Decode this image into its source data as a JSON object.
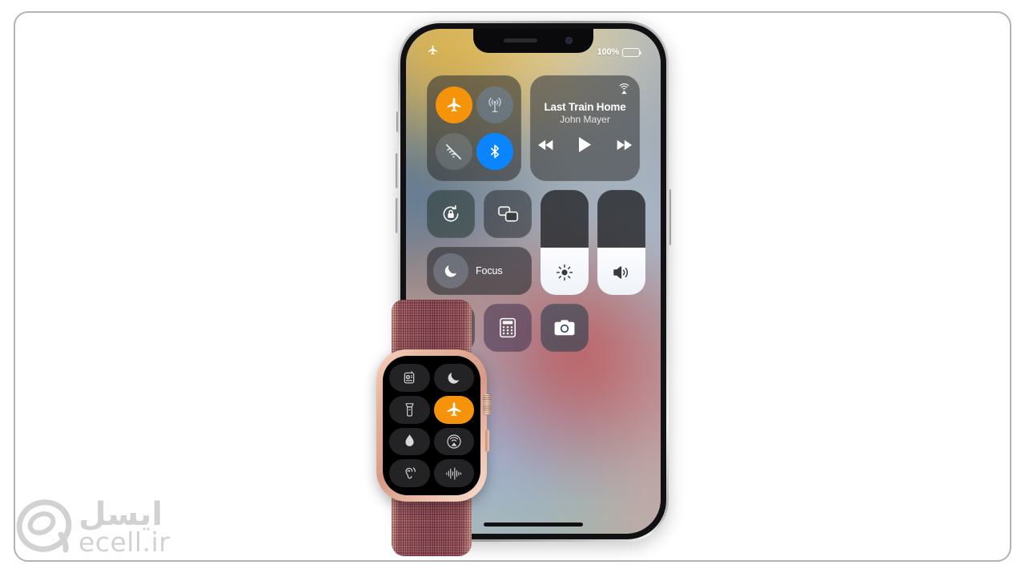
{
  "page": {
    "background_color": "#ffffff",
    "border_color": "#b3b3b3"
  },
  "iphone": {
    "status_bar": {
      "airplane_icon": "airplane-icon",
      "battery_percent": "100%",
      "battery_icon": "battery-full-icon"
    },
    "control_center": {
      "connectivity": {
        "label": "connectivity-module",
        "toggles": [
          {
            "name": "airplane-mode",
            "icon": "airplane-icon",
            "state": "on",
            "color": "#F5930A"
          },
          {
            "name": "cellular-data",
            "icon": "cellular-icon",
            "state": "dimmed",
            "color": "#6E87A5"
          },
          {
            "name": "wifi",
            "icon": "wifi-off-icon",
            "state": "off",
            "color": "#96A0AA"
          },
          {
            "name": "bluetooth",
            "icon": "bluetooth-icon",
            "state": "on",
            "color": "#0A84FF"
          }
        ]
      },
      "now_playing": {
        "title": "Last Train Home",
        "artist": "John Mayer",
        "airplay_icon": "airplay-audio-icon",
        "controls": [
          {
            "name": "rewind-button",
            "icon": "rewind-icon"
          },
          {
            "name": "play-button",
            "icon": "play-icon"
          },
          {
            "name": "forward-button",
            "icon": "fast-forward-icon"
          }
        ]
      },
      "toggles": [
        {
          "name": "rotation-lock",
          "icon": "rotation-lock-icon",
          "tint": "green"
        },
        {
          "name": "screen-mirror",
          "icon": "screen-mirroring-icon",
          "tint": "gray"
        }
      ],
      "focus": {
        "label": "Focus",
        "icon": "moon-icon"
      },
      "sliders": [
        {
          "name": "brightness-slider",
          "icon": "brightness-icon",
          "value": 45
        },
        {
          "name": "volume-slider",
          "icon": "volume-icon",
          "value": 45
        }
      ],
      "shortcuts": [
        {
          "name": "timer",
          "icon": "timer-icon",
          "tint": "gray"
        },
        {
          "name": "calculator",
          "icon": "calculator-icon",
          "tint": "purple"
        },
        {
          "name": "camera",
          "icon": "camera-icon",
          "tint": "blue"
        }
      ]
    },
    "hardware": {
      "notch": "notch",
      "speaker": "earpiece-speaker",
      "front_camera": "front-camera-icon",
      "home_indicator": "home-indicator",
      "mute_switch": "mute-switch-button",
      "volume_up": "volume-up-button",
      "volume_down": "volume-down-button",
      "power": "power-button"
    }
  },
  "apple_watch": {
    "case_color": "#e0a68f",
    "band_color": "#8d3f4c",
    "control_center": {
      "buttons": [
        {
          "name": "walkie-talkie",
          "icon": "walkie-talkie-icon",
          "state": "off"
        },
        {
          "name": "do-not-disturb",
          "icon": "moon-icon",
          "state": "off"
        },
        {
          "name": "flashlight",
          "icon": "flashlight-icon",
          "state": "off"
        },
        {
          "name": "airplane-mode",
          "icon": "airplane-icon",
          "state": "on"
        },
        {
          "name": "water-lock",
          "icon": "water-drop-icon",
          "state": "off"
        },
        {
          "name": "airplay",
          "icon": "airplay-audio-icon",
          "state": "off"
        },
        {
          "name": "hearing",
          "icon": "ear-icon",
          "state": "off"
        },
        {
          "name": "noise-level",
          "icon": "sound-wave-icon",
          "state": "off"
        }
      ],
      "active_color": "#F5930A"
    },
    "hardware": {
      "digital_crown": "digital-crown",
      "side_button": "side-button"
    }
  },
  "watermark": {
    "persian": "ایسل",
    "latin": "ecell.ir",
    "logo": "ecell-logo-icon"
  }
}
